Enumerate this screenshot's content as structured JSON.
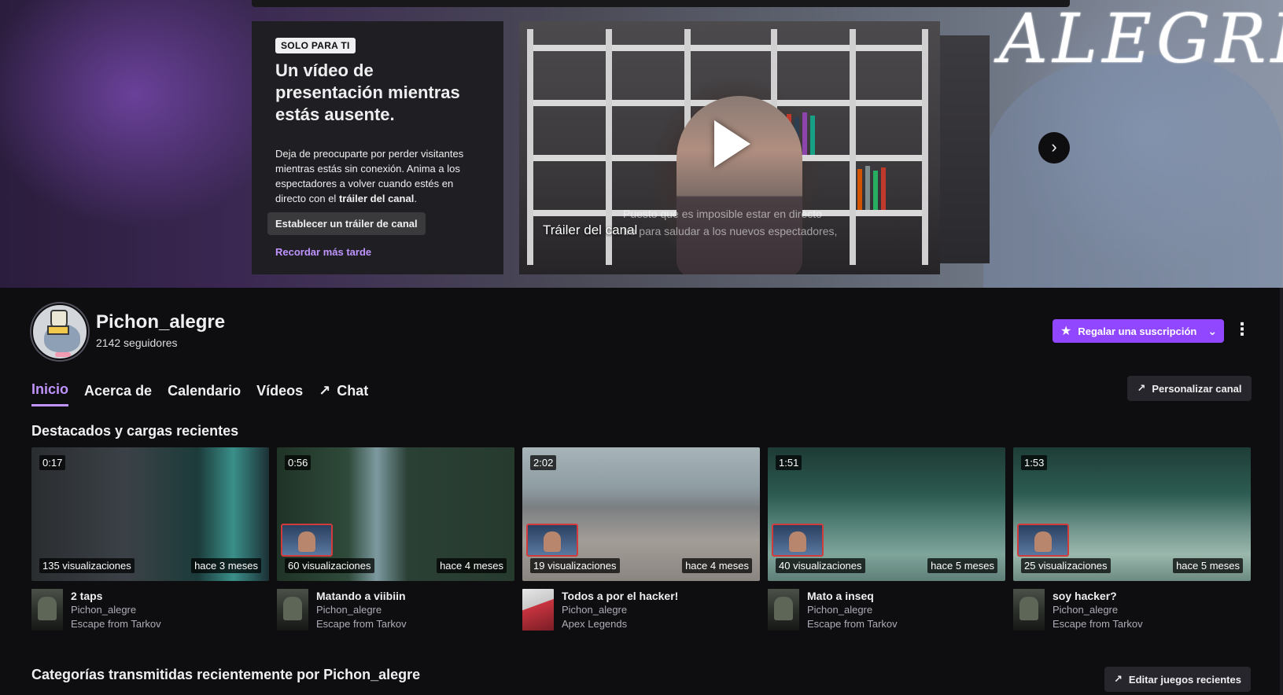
{
  "banner": {
    "art_text": "ALEGRE"
  },
  "promo": {
    "badge": "SOLO PARA TI",
    "title": "Un vídeo de presentación mientras estás ausente.",
    "text_before": "Deja de preocuparte por perder visitantes mientras estás sin conexión. Anima a los espectadores a volver cuando estés en directo con el ",
    "text_bold": "tráiler del canal",
    "text_after": ".",
    "set_button": "Establecer un tráiler de canal",
    "remind_link": "Recordar más tarde"
  },
  "trailer": {
    "label": "Tráiler del canal",
    "subtitle_line1": "Puesto que es imposible estar en directo",
    "subtitle_line2": "tro para saludar a los nuevos espectadores,"
  },
  "channel": {
    "name": "Pichon_alegre",
    "followers": "2142 seguidores",
    "gift_button": "Regalar una suscripción"
  },
  "tabs": [
    {
      "label": "Inicio"
    },
    {
      "label": "Acerca de"
    },
    {
      "label": "Calendario"
    },
    {
      "label": "Vídeos"
    },
    {
      "label": "Chat"
    }
  ],
  "customize_button": "Personalizar canal",
  "section_featured": "Destacados y cargas recientes",
  "videos": [
    {
      "duration": "0:17",
      "views": "135 visualizaciones",
      "age": "hace 3 meses",
      "title": "2 taps",
      "channel": "Pichon_alegre",
      "game": "Escape from Tarkov"
    },
    {
      "duration": "0:56",
      "views": "60 visualizaciones",
      "age": "hace 4 meses",
      "title": "Matando a viibiin",
      "channel": "Pichon_alegre",
      "game": "Escape from Tarkov"
    },
    {
      "duration": "2:02",
      "views": "19 visualizaciones",
      "age": "hace 4 meses",
      "title": "Todos a por el hacker!",
      "channel": "Pichon_alegre",
      "game": "Apex Legends"
    },
    {
      "duration": "1:51",
      "views": "40 visualizaciones",
      "age": "hace 5 meses",
      "title": "Mato a inseq",
      "channel": "Pichon_alegre",
      "game": "Escape from Tarkov"
    },
    {
      "duration": "1:53",
      "views": "25 visualizaciones",
      "age": "hace 5 meses",
      "title": "soy hacker?",
      "channel": "Pichon_alegre",
      "game": "Escape from Tarkov"
    }
  ],
  "section_categories": "Categorías transmitidas recientemente por Pichon_alegre",
  "edit_games_button": "Editar juegos recientes",
  "colors": {
    "accent": "#9147ff",
    "accent_text": "#bf94ff",
    "background": "#0e0e10"
  },
  "icons": [
    "play-icon",
    "chevron-right-icon",
    "star-icon",
    "chevron-down-icon",
    "more-vertical-icon",
    "external-arrow-icon"
  ]
}
